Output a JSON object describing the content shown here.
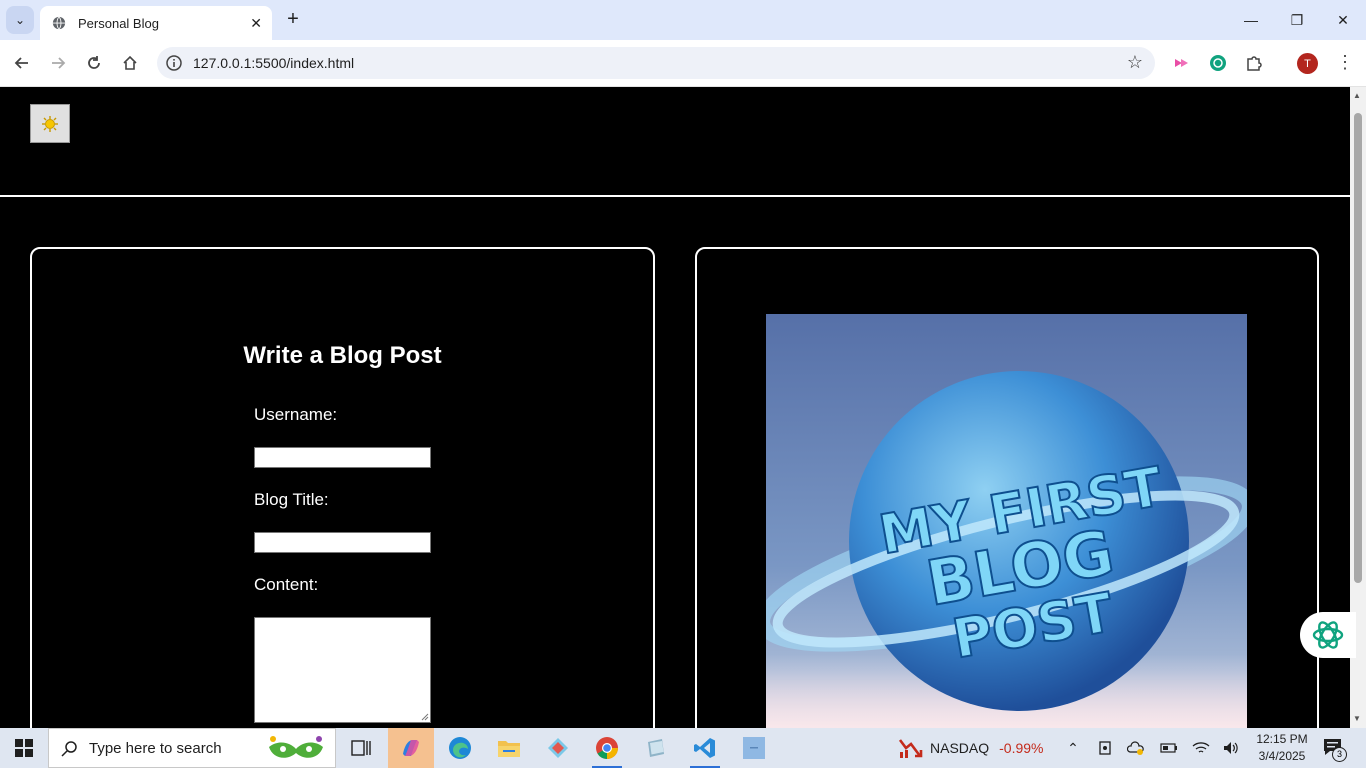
{
  "browser": {
    "tab_title": "Personal Blog",
    "url": "127.0.0.1:5500/index.html",
    "profile_initial": "T"
  },
  "page": {
    "theme_toggle_icon": "sun-icon",
    "form": {
      "title": "Write a Blog Post",
      "username_label": "Username:",
      "blog_title_label": "Blog Title:",
      "content_label": "Content:",
      "username_value": "",
      "blog_title_value": "",
      "content_value": ""
    },
    "image": {
      "alt_text_rendered": [
        "MY FIRST",
        "BLOG",
        "POST"
      ]
    }
  },
  "taskbar": {
    "search_placeholder": "Type here to search",
    "stock_name": "NASDAQ",
    "stock_change": "-0.99%",
    "time": "12:15 PM",
    "date": "3/4/2025",
    "notification_count": "3"
  },
  "colors": {
    "page_bg": "#000000",
    "card_border": "#ffffff",
    "stock_negative": "#c42b1c",
    "taskbar_bg": "#dfe6f1"
  }
}
